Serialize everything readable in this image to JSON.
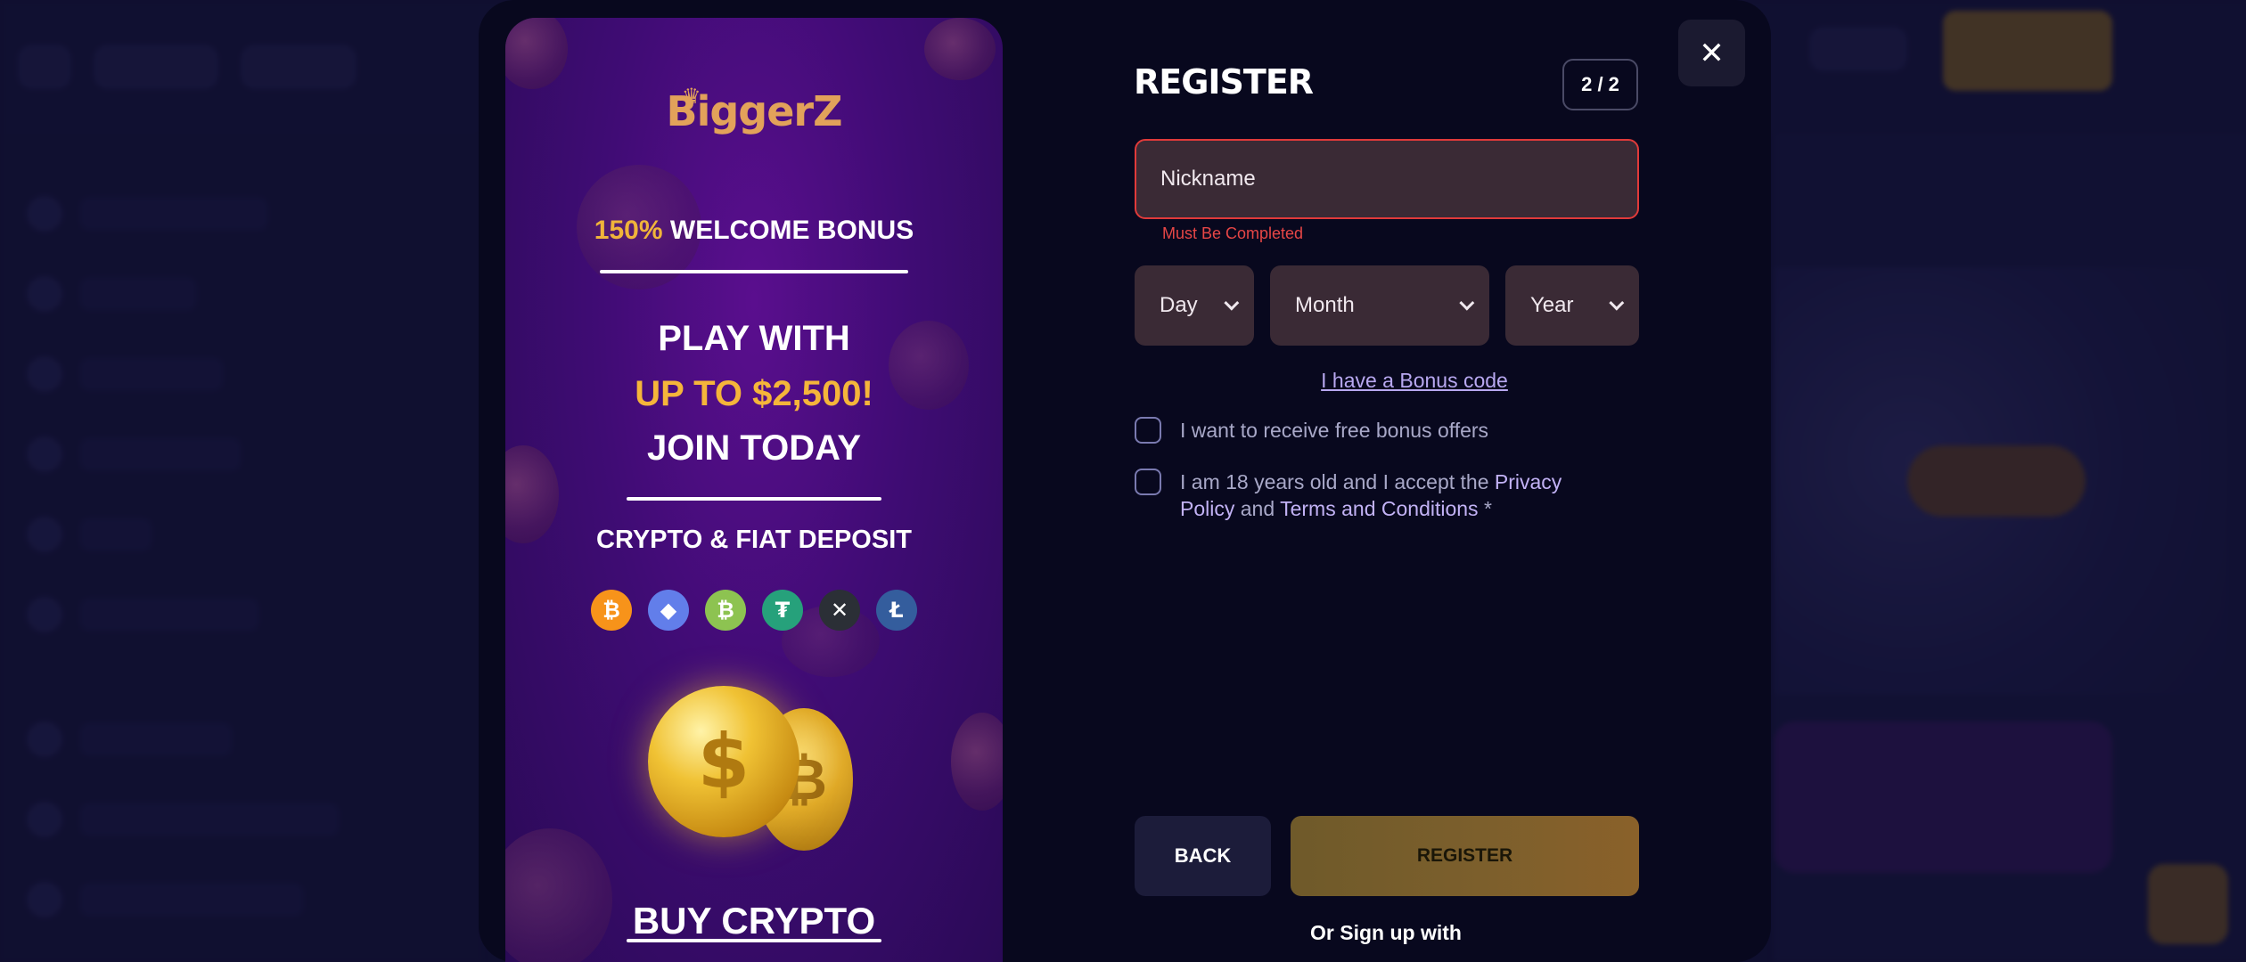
{
  "promo": {
    "logo_text": "BiggerZ",
    "bonus_percent": "150%",
    "bonus_text": "WELCOME BONUS",
    "play_with": "PLAY WITH",
    "up_to": "UP TO $2,500!",
    "join_today": "JOIN TODAY",
    "crypto_fiat": "CRYPTO & FIAT DEPOSIT",
    "crypto_icons": [
      {
        "name": "bitcoin-icon",
        "glyph": "₿",
        "color": "#f7931a"
      },
      {
        "name": "ethereum-icon",
        "glyph": "◆",
        "color": "#627eea"
      },
      {
        "name": "bitcoin-cash-icon",
        "glyph": "₿",
        "color": "#8dc351"
      },
      {
        "name": "tether-icon",
        "glyph": "₮",
        "color": "#26a17b"
      },
      {
        "name": "xrp-icon",
        "glyph": "✕",
        "color": "#2b2f36"
      },
      {
        "name": "litecoin-icon",
        "glyph": "Ł",
        "color": "#345d9d"
      }
    ],
    "buy_crypto": "BUY CRYPTO"
  },
  "form": {
    "title": "REGISTER",
    "step": "2 / 2",
    "close_glyph": "✕",
    "nickname_placeholder": "Nickname",
    "nickname_error": "Must Be Completed",
    "day_label": "Day",
    "month_label": "Month",
    "year_label": "Year",
    "bonus_code_link": "I have a Bonus code",
    "offers_label": "I want to receive free bonus offers",
    "age_prefix": "I am 18 years old and I accept the",
    "privacy_policy": "Privacy Policy",
    "and_text": "and",
    "terms": "Terms and Conditions",
    "required_mark": "*",
    "back_label": "BACK",
    "register_label": "REGISTER",
    "signup_with": "Or Sign up with"
  },
  "colors": {
    "accent_gold": "#f5b53a",
    "error_red": "#e03a3a",
    "link_purple": "#b8a8f0",
    "modal_bg": "#08081e"
  }
}
